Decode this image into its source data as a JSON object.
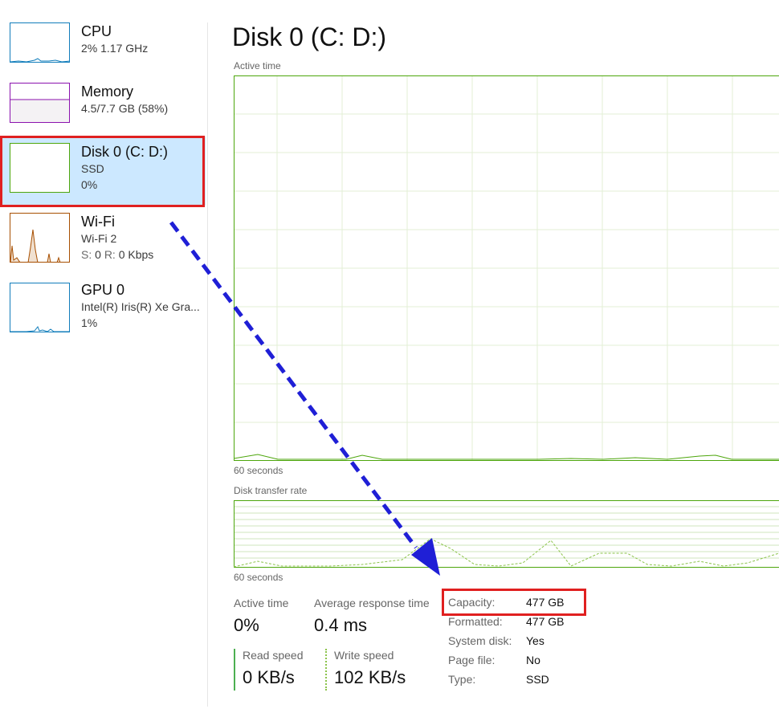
{
  "sidebar": {
    "items": [
      {
        "title": "CPU",
        "line1": "2%  1.17 GHz",
        "line2": "",
        "color": "#117dbb",
        "thumb_fill": "#ffffff"
      },
      {
        "title": "Memory",
        "line1": "4.5/7.7 GB (58%)",
        "line2": "",
        "color": "#8b12ae",
        "thumb_fill": "#f4f2f4"
      },
      {
        "title": "Disk 0 (C: D:)",
        "line1": "SSD",
        "line2": "0%",
        "color": "#4da60c",
        "thumb_fill": "#ffffff"
      },
      {
        "title": "Wi-Fi",
        "line1": "Wi-Fi 2",
        "line2_s": "S:",
        "line2_s_val": "0",
        "line2_r": "R:",
        "line2_r_val": "0 Kbps",
        "color": "#a74f01"
      },
      {
        "title": "GPU 0",
        "line1": "Intel(R) Iris(R) Xe Gra...",
        "line2": "1%",
        "color": "#117dbb"
      }
    ],
    "selected_index": 2
  },
  "main": {
    "title": "Disk 0 (C: D:)",
    "graph1": {
      "label": "Active time",
      "footer": "60 seconds"
    },
    "graph2": {
      "label": "Disk transfer rate",
      "footer": "60 seconds"
    },
    "stats": {
      "active_time_label": "Active time",
      "active_time_value": "0%",
      "avg_response_label": "Average response time",
      "avg_response_value": "0.4 ms",
      "read_speed_label": "Read speed",
      "read_speed_value": "0 KB/s",
      "write_speed_label": "Write speed",
      "write_speed_value": "102 KB/s"
    },
    "properties": [
      {
        "label": "Capacity:",
        "value": "477 GB"
      },
      {
        "label": "Formatted:",
        "value": "477 GB"
      },
      {
        "label": "System disk:",
        "value": "Yes"
      },
      {
        "label": "Page file:",
        "value": "No"
      },
      {
        "label": "Type:",
        "value": "SSD"
      }
    ]
  },
  "annotations": {
    "highlight_color": "#e02020",
    "arrow_color": "#1f1fd6"
  },
  "colors": {
    "disk_green": "#4da60c",
    "selected_bg": "#cce8ff"
  }
}
